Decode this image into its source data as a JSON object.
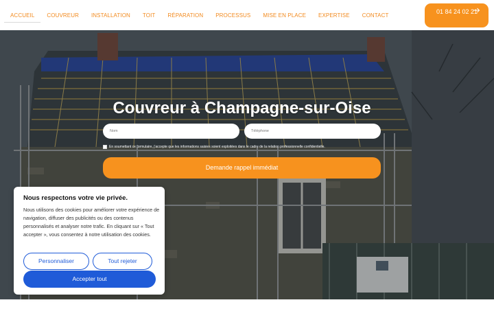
{
  "nav": {
    "items": [
      {
        "label": "ACCUEIL"
      },
      {
        "label": "COUVREUR"
      },
      {
        "label": "INSTALLATION"
      },
      {
        "label": "TOIT"
      },
      {
        "label": "RÉPARATION"
      },
      {
        "label": "PROCESSUS"
      },
      {
        "label": "MISE EN PLACE"
      },
      {
        "label": "EXPERTISE"
      },
      {
        "label": "CONTACT"
      }
    ],
    "phone": "01 84 24 02 21",
    "phone_icon": "arrow-right-icon"
  },
  "hero": {
    "title": "Couvreur à Champagne-sur-Oise",
    "form": {
      "name_placeholder": "Nom",
      "phone_placeholder": "Téléphone",
      "consent_text": "En soumettant ce formulaire, j'accepte que les informations saisies soient exploitées dans le cadre de la relation professionnelle confidentielle.",
      "submit_label": "Demande rappel immédiat"
    }
  },
  "cookie": {
    "title": "Nous respectons votre vie privée.",
    "text": "Nous utilisons des cookies pour améliorer votre expérience de navigation, diffuser des publicités ou des contenus personnalisés et analyser notre trafic. En cliquant sur « Tout accepter », vous consentez à notre utilisation des cookies.",
    "customize_label": "Personnaliser",
    "reject_label": "Tout rejeter",
    "accept_label": "Accepter tout"
  },
  "colors": {
    "accent": "#f7921e",
    "cookie_button": "#1f5bd8"
  }
}
